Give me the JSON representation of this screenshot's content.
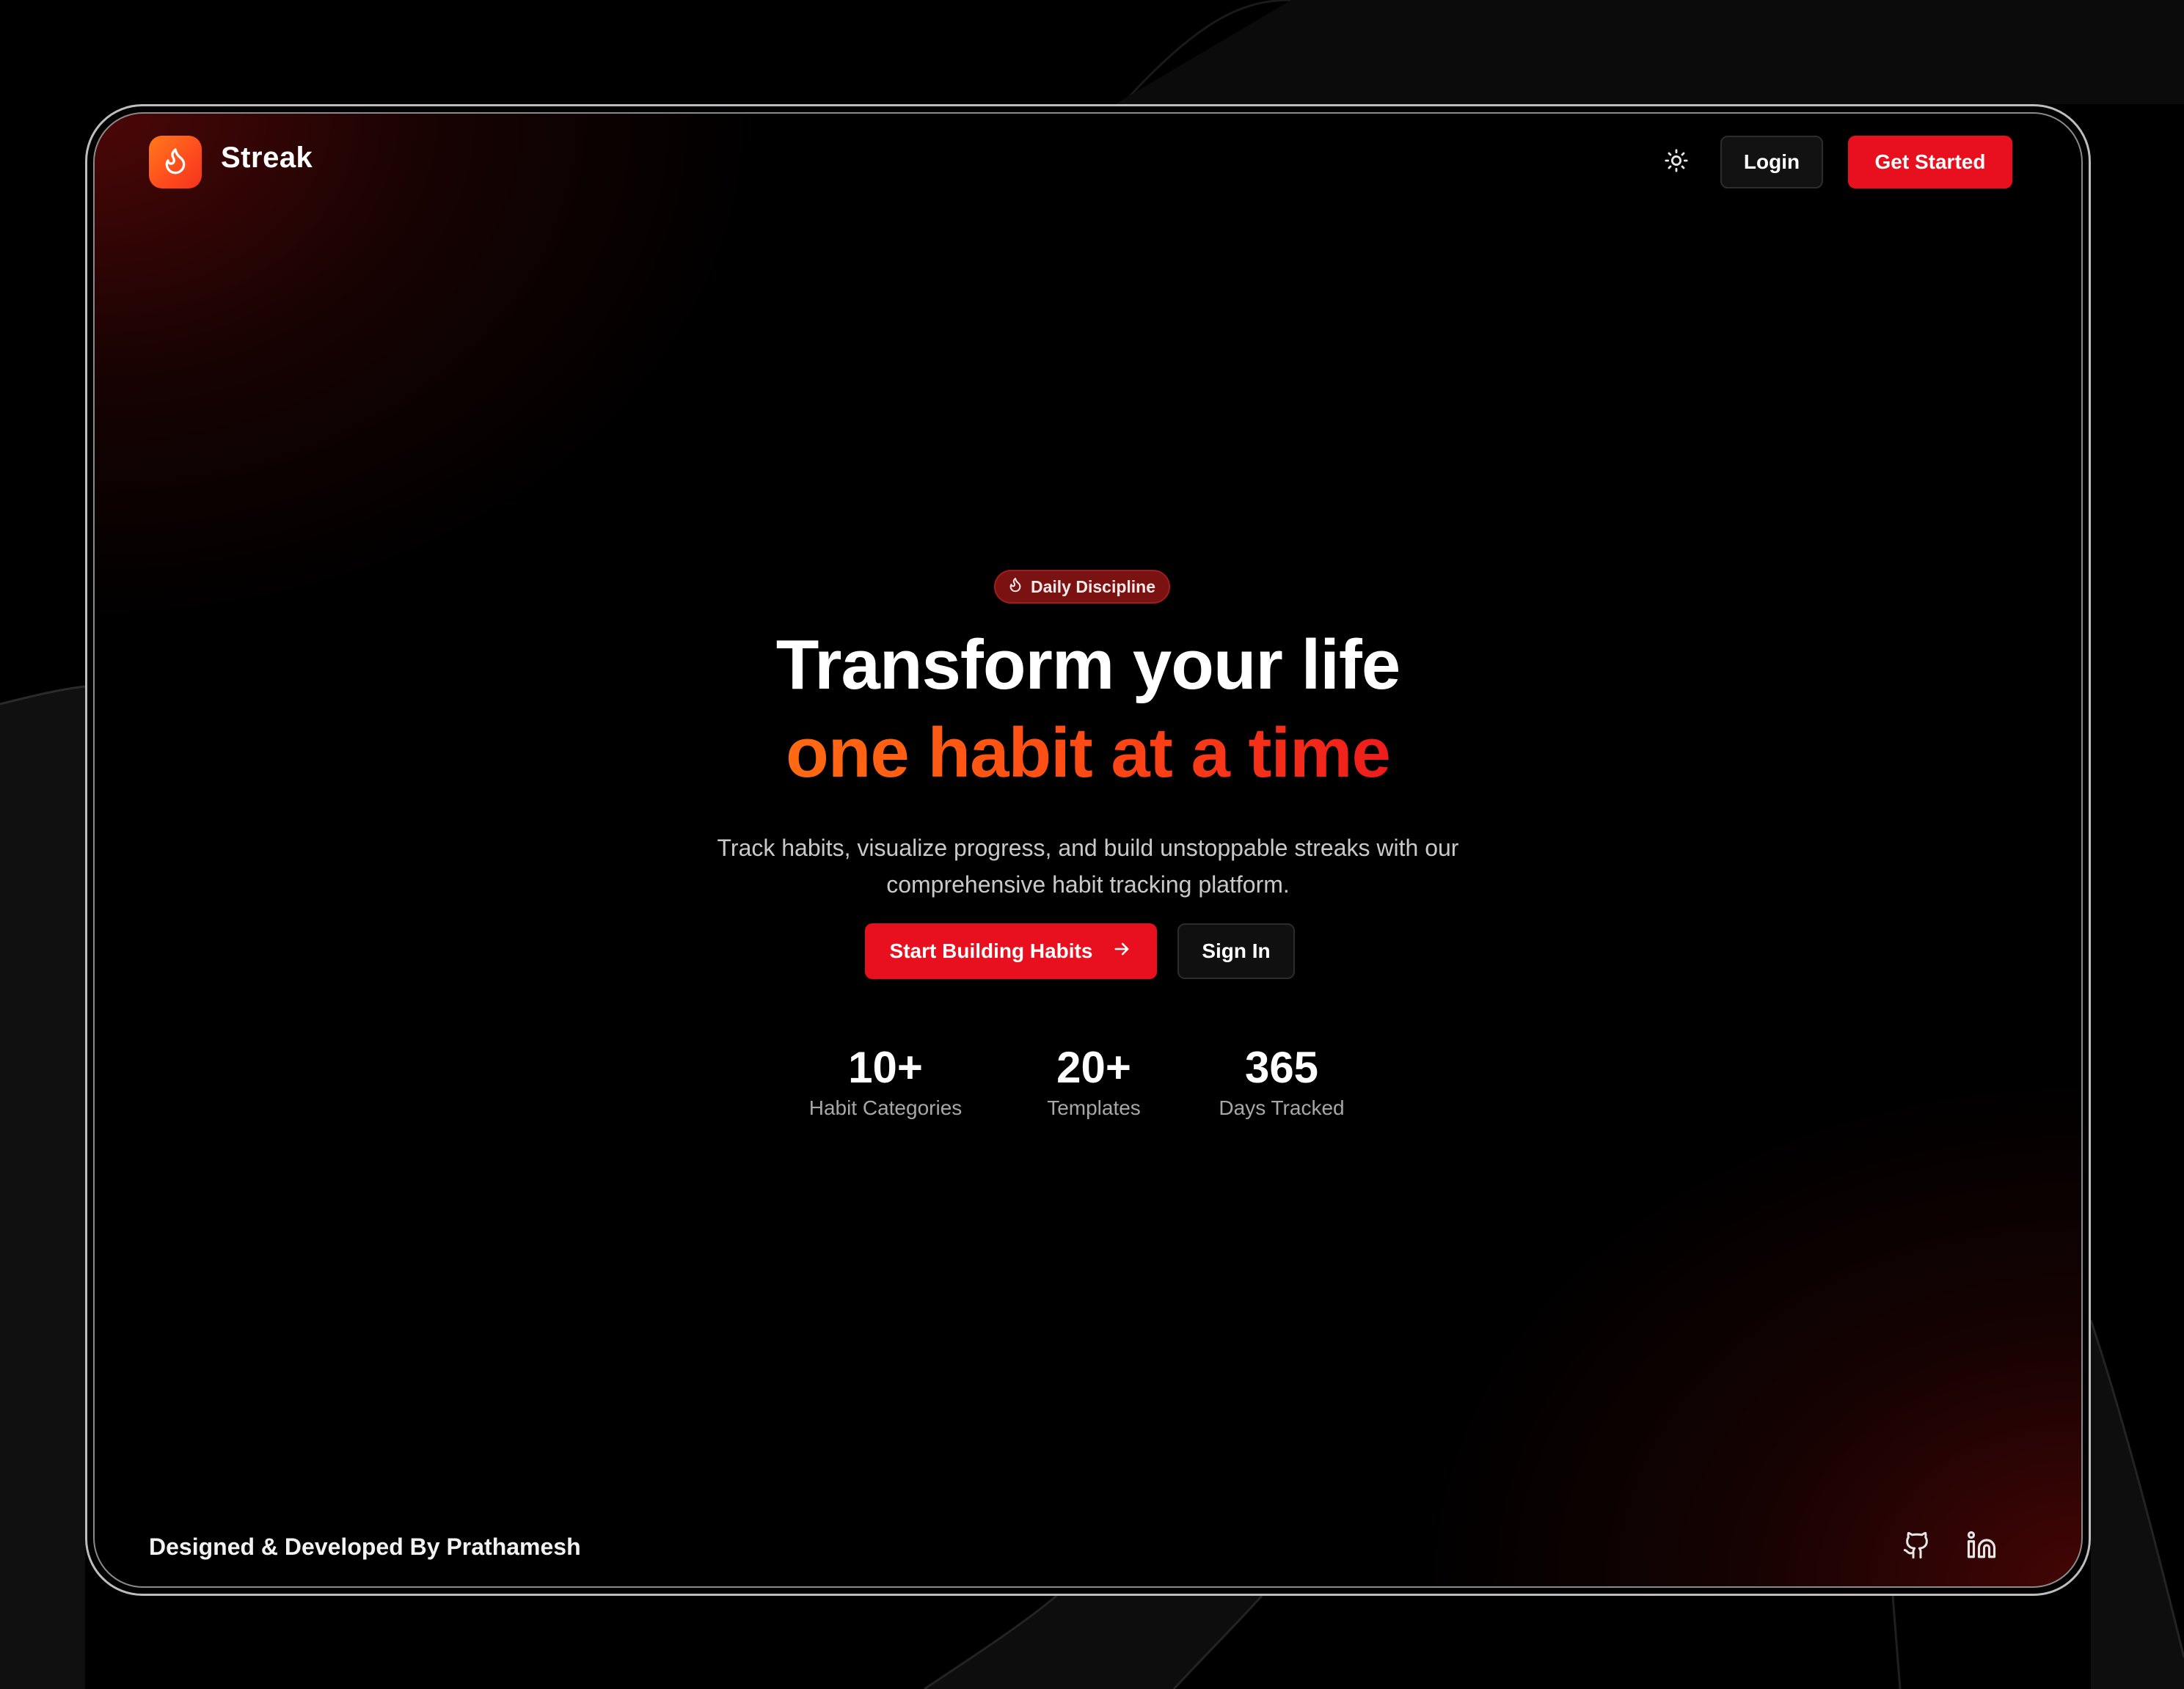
{
  "brand": {
    "name": "Streak",
    "logo_icon": "flame-icon",
    "logo_gradient": [
      "#ff7a1a",
      "#f2341c"
    ]
  },
  "nav": {
    "theme_toggle_icon": "sun-icon",
    "login_label": "Login",
    "get_started_label": "Get Started"
  },
  "hero": {
    "badge_icon": "flame-icon",
    "badge_label": "Daily Discipline",
    "title_line1": "Transform your life",
    "title_line2": "one habit at a time",
    "subtitle_line1": "Track habits, visualize progress, and build unstoppable streaks with our",
    "subtitle_line2": "comprehensive habit tracking platform.",
    "primary_cta": "Start Building Habits",
    "primary_cta_icon": "arrow-right-icon",
    "secondary_cta": "Sign In"
  },
  "stats": [
    {
      "value": "10+",
      "label": "Habit Categories"
    },
    {
      "value": "20+",
      "label": "Templates"
    },
    {
      "value": "365",
      "label": "Days Tracked"
    }
  ],
  "footer": {
    "credit": "Designed & Developed By Prathamesh",
    "social_icons": [
      "github-icon",
      "linkedin-icon"
    ]
  },
  "colors": {
    "accent": "#e8101e",
    "orange": "#ff6a12",
    "background": "#000000",
    "badge_bg": "#7a1212"
  }
}
